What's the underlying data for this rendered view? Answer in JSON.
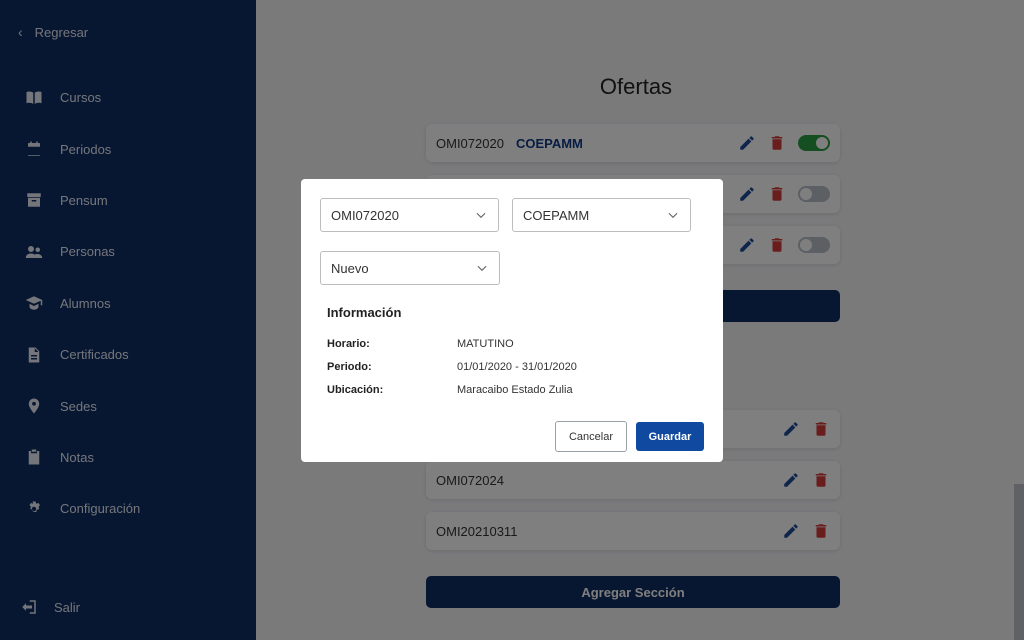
{
  "sidebar": {
    "back_label": "Regresar",
    "items": [
      {
        "label": "Cursos",
        "icon": "book-icon"
      },
      {
        "label": "Periodos",
        "icon": "calendar-icon"
      },
      {
        "label": "Pensum",
        "icon": "archive-icon"
      },
      {
        "label": "Personas",
        "icon": "people-icon"
      },
      {
        "label": "Alumnos",
        "icon": "graduation-cap-icon"
      },
      {
        "label": "Certificados",
        "icon": "document-icon"
      },
      {
        "label": "Sedes",
        "icon": "location-pin-icon"
      },
      {
        "label": "Notas",
        "icon": "clipboard-icon"
      },
      {
        "label": "Configuración",
        "icon": "gear-icon"
      }
    ],
    "logout_label": "Salir"
  },
  "main": {
    "title": "Ofertas",
    "offers": [
      {
        "code": "OMI072020",
        "tag": "COEPAMM",
        "active": true
      },
      {
        "code": "",
        "tag": "",
        "active": false
      },
      {
        "code": "",
        "tag": "",
        "active": false
      }
    ],
    "sections": [
      {
        "code": ""
      },
      {
        "code": "OMI072024"
      },
      {
        "code": "OMI20210311"
      }
    ],
    "add_section_label": "Agregar Sección"
  },
  "modal": {
    "select_offer": "OMI072020",
    "select_org": "COEPAMM",
    "select_status": "Nuevo",
    "info_title": "Información",
    "rows": [
      {
        "label": "Horario:",
        "value": "MATUTINO"
      },
      {
        "label": "Periodo:",
        "value": "01/01/2020 - 31/01/2020"
      },
      {
        "label": "Ubicación:",
        "value": "Maracaibo Estado Zulia"
      }
    ],
    "cancel_label": "Cancelar",
    "save_label": "Guardar"
  },
  "colors": {
    "sidebar_bg": "#0f2d62",
    "primary_button": "#0f4aa0",
    "toggle_on": "#2a9d43",
    "delete_red": "#d23b3b"
  }
}
